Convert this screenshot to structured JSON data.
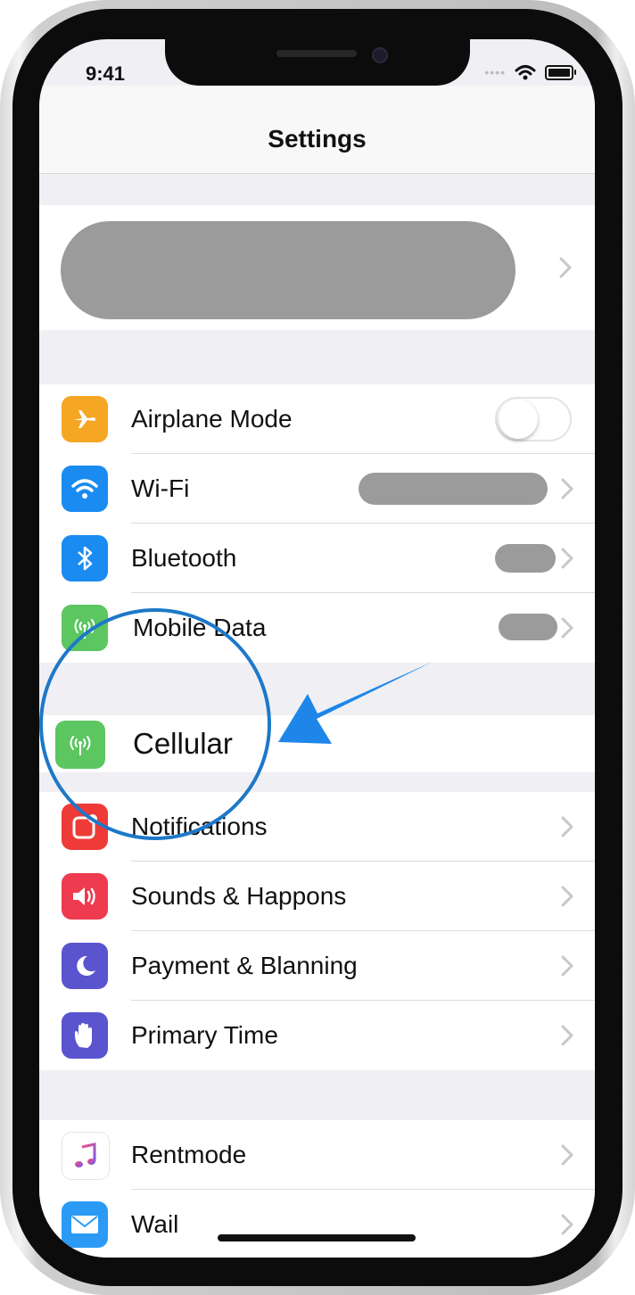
{
  "status_bar": {
    "time": "9:41"
  },
  "nav": {
    "title": "Settings"
  },
  "group_connectivity": [
    {
      "label": "Airplane Mode",
      "icon": "airplane-icon",
      "color": "#f5a623",
      "toggle_on": false
    },
    {
      "label": "Wi-Fi",
      "icon": "wifi-icon",
      "color": "#1a8bf0"
    },
    {
      "label": "Bluetooth",
      "icon": "bluetooth-icon",
      "color": "#1a8bf0"
    },
    {
      "label": "Mobile Data",
      "icon": "antenna-icon",
      "color": "#5cc660"
    }
  ],
  "cellular": {
    "label": "Cellular",
    "icon": "antenna-icon",
    "color": "#5cc660"
  },
  "group_alerts": [
    {
      "label": "Notifications",
      "icon": "notifications-icon",
      "color": "#ee3b37"
    },
    {
      "label": "Sounds & Happons",
      "icon": "speaker-icon",
      "color": "#ee3b4f"
    },
    {
      "label": "Payment & Blanning",
      "icon": "moon-icon",
      "color": "#5b54cf"
    },
    {
      "label": "Primary Time",
      "icon": "hand-icon",
      "color": "#5b54cf"
    }
  ],
  "group_apps": [
    {
      "label": "Rentmode",
      "icon": "music-note-icon",
      "color": "#ffffff"
    },
    {
      "label": "Wail",
      "icon": "mail-icon",
      "color": "#2a9af4"
    }
  ],
  "annotation": {
    "circle_color": "#1d78c8",
    "arrow_color": "#1d86e8"
  }
}
